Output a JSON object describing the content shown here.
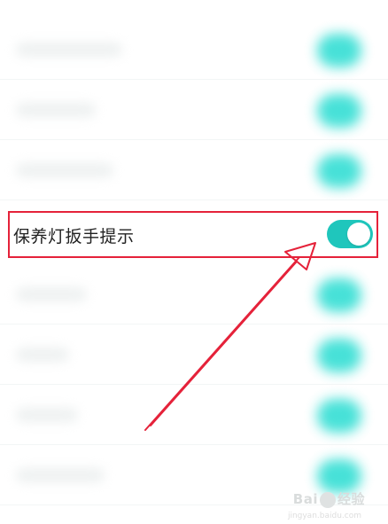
{
  "setting": {
    "label": "保养灯扳手提示",
    "enabled": true
  },
  "colors": {
    "accent": "#1fc6bc",
    "annotation": "#e5223a"
  },
  "watermark": {
    "brand": "Bai",
    "brand_suffix": "经验",
    "url": "jingyan.baidu.com"
  }
}
